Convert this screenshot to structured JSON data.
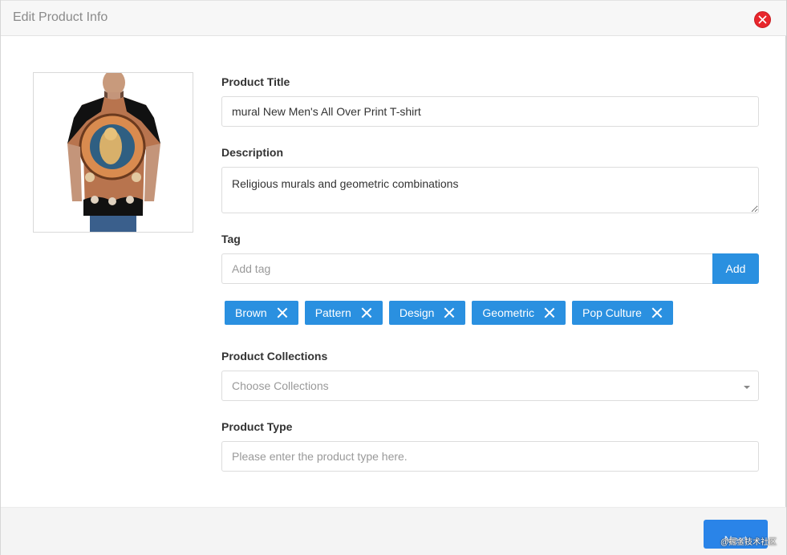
{
  "header": {
    "title": "Edit Product Info"
  },
  "form": {
    "product_title": {
      "label": "Product Title",
      "value": "mural New Men's All Over Print T-shirt"
    },
    "description": {
      "label": "Description",
      "value": "Religious murals and geometric combinations"
    },
    "tag": {
      "label": "Tag",
      "placeholder": "Add tag",
      "add_label": "Add",
      "items": [
        "Brown",
        "Pattern",
        "Design",
        "Geometric",
        "Pop Culture"
      ]
    },
    "collections": {
      "label": "Product Collections",
      "placeholder": "Choose Collections"
    },
    "product_type": {
      "label": "Product Type",
      "placeholder": "Please enter the product type here."
    }
  },
  "footer": {
    "next_label": "Next",
    "watermark": "@掘金技术社区"
  },
  "colors": {
    "accent": "#2a90e0",
    "close": "#e8262c"
  },
  "icons": {
    "close": "close-circle-icon",
    "tag_remove": "close-icon",
    "select": "caret-down-icon"
  }
}
